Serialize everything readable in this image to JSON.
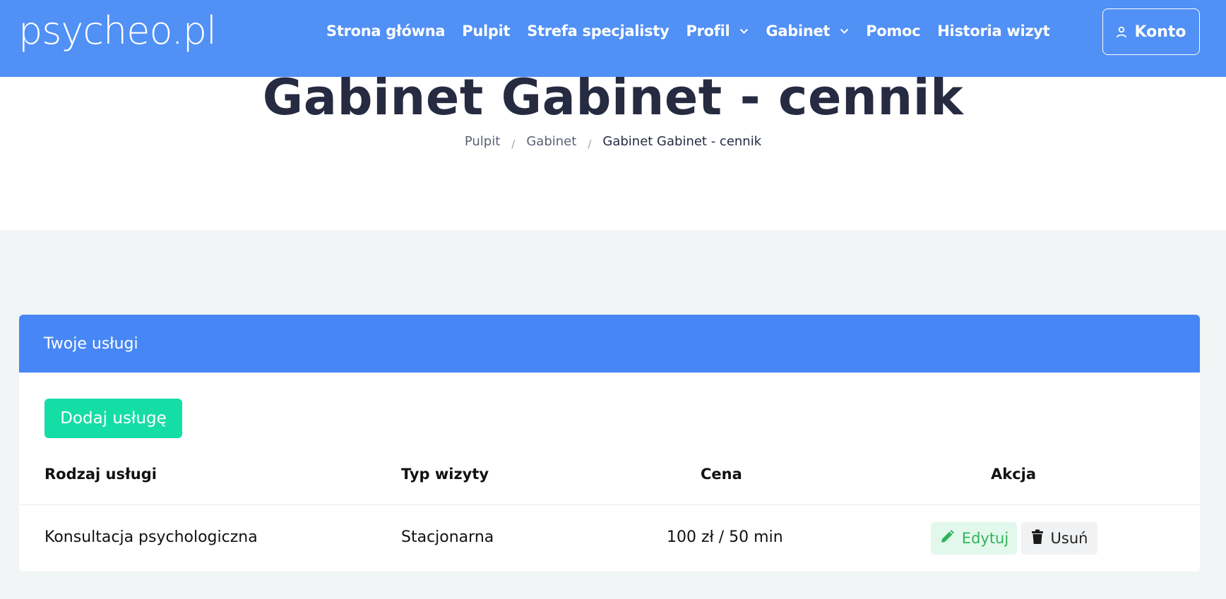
{
  "header": {
    "logo": "psycheo.pl",
    "nav": [
      {
        "label": "Strona główna",
        "dropdown": false
      },
      {
        "label": "Pulpit",
        "dropdown": false
      },
      {
        "label": "Strefa specjalisty",
        "dropdown": false
      },
      {
        "label": "Profil",
        "dropdown": true
      },
      {
        "label": "Gabinet",
        "dropdown": true
      },
      {
        "label": "Pomoc",
        "dropdown": false
      },
      {
        "label": "Historia wizyt",
        "dropdown": false
      }
    ],
    "account_label": "Konto"
  },
  "page": {
    "title": "Gabinet Gabinet - cennik",
    "breadcrumb": [
      "Pulpit",
      "Gabinet",
      "Gabinet Gabinet - cennik"
    ],
    "breadcrumb_sep": "/"
  },
  "card": {
    "title": "Twoje usługi",
    "add_button": "Dodaj usługę",
    "columns": [
      "Rodzaj usługi",
      "Typ wizyty",
      "Cena",
      "Akcja"
    ],
    "rows": [
      {
        "service": "Konsultacja psychologiczna",
        "visit_type": "Stacjonarna",
        "price": "100 zł / 50 min",
        "edit_label": "Edytuj",
        "delete_label": "Usuń"
      }
    ]
  },
  "colors": {
    "header_bg": "#5190f5",
    "card_header_bg": "#4787f5",
    "add_button_bg": "#15dda6",
    "edit_button_bg": "#e3f8ec",
    "edit_button_text": "#2fb35c",
    "page_bg": "#f2f5f5",
    "title_color": "#262b41"
  },
  "icons": {
    "account": "user-icon",
    "dropdown": "chevron-down-icon",
    "edit": "pencil-icon",
    "delete": "trash-icon"
  }
}
